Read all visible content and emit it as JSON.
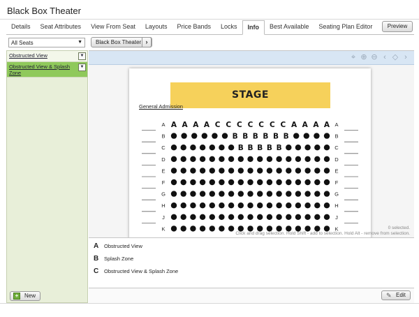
{
  "app": {
    "title": "Black Box Theater"
  },
  "tabs": [
    {
      "label": "Details"
    },
    {
      "label": "Seat Attributes"
    },
    {
      "label": "View From Seat"
    },
    {
      "label": "Layouts"
    },
    {
      "label": "Price Bands"
    },
    {
      "label": "Locks"
    },
    {
      "label": "Info",
      "active": true
    },
    {
      "label": "Best Available"
    },
    {
      "label": "Seating Plan Editor"
    }
  ],
  "preview_label": "Preview",
  "filter": {
    "selected": "All Seats"
  },
  "venue_button": {
    "label": "Black Box Theater",
    "icon": "chevron-right-icon"
  },
  "zones": [
    {
      "label": "Obstructed View"
    },
    {
      "label": "Obstructed View & Splash Zone",
      "selected": true
    }
  ],
  "new_label": "New",
  "edit_label": "Edit",
  "colors": {
    "selected_zone": "#8fc95b",
    "stage": "#f6d15b",
    "panel": "#e8efd9",
    "map_toolbar": "#d8e6f4"
  },
  "plan": {
    "stage_label": "STAGE",
    "ga_label": "General Admission",
    "rows": [
      {
        "label": "A",
        "seats": "AAAACCCCCCCAAAA"
      },
      {
        "label": "B",
        "seats": "●●●●●●BBBBBB●●●●"
      },
      {
        "label": "C",
        "seats": "●●●●●●●BBBBB●●●●●"
      },
      {
        "label": "D",
        "seats": "●●●●●●●●●●●●●●●●●"
      },
      {
        "label": "E",
        "seats": "●●●●●●●●●●●●●●●●●"
      },
      {
        "label": "F",
        "seats": "●●●●●●●●●●●●●●●●●"
      },
      {
        "label": "G",
        "seats": "●●●●●●●●●●●●●●●●●"
      },
      {
        "label": "H",
        "seats": "●●●●●●●●●●●●●●●●●"
      },
      {
        "label": "J",
        "seats": "●●●●●●●●●●●●●●●●●"
      },
      {
        "label": "K",
        "seats": "●●●●●●●●●●●●●●●●●"
      }
    ],
    "selection_count": "0 selected.",
    "selection_hint": "Click and drag selection. Hold Shift - add to selection. Hold Alt - remove from selection."
  },
  "legend": [
    {
      "key": "A",
      "name": "Obstructed View"
    },
    {
      "key": "B",
      "name": "Splash Zone"
    },
    {
      "key": "C",
      "name": "Obstructed View & Splash Zone"
    }
  ],
  "map_tools": [
    "crosshair-icon",
    "zoom-in-icon",
    "zoom-out-icon",
    "pan-left-icon",
    "pan-up-down-icon",
    "pan-right-icon"
  ]
}
